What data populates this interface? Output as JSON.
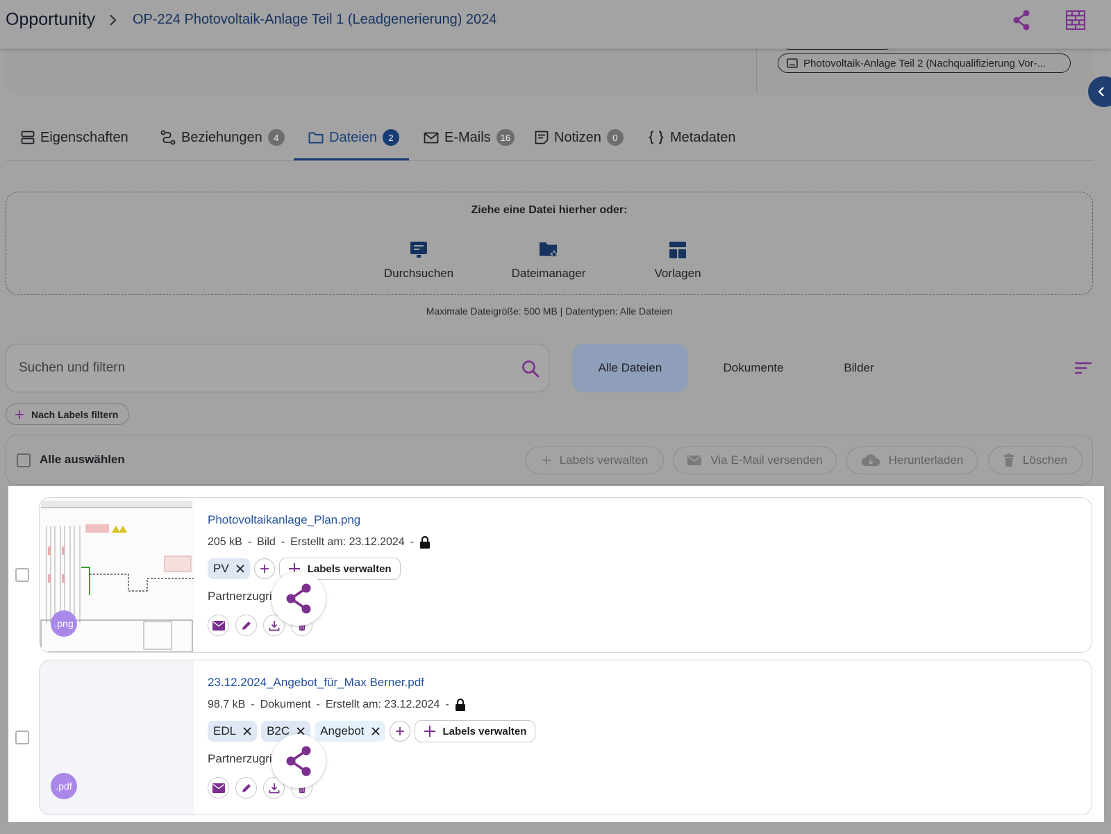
{
  "header": {
    "breadcrumb_root": "Opportunity",
    "breadcrumb_current": "OP-224 Photovoltaik-Anlage Teil 1 (Leadgenerierung) 2024"
  },
  "related": {
    "chip_label": "Photovoltaik-Anlage Teil 2 (Nachqualifizierung Vor-..."
  },
  "tabs": [
    {
      "label": "Eigenschaften",
      "badge": ""
    },
    {
      "label": "Beziehungen",
      "badge": "4"
    },
    {
      "label": "Dateien",
      "badge": "2"
    },
    {
      "label": "E-Mails",
      "badge": "16"
    },
    {
      "label": "Notizen",
      "badge": "0"
    },
    {
      "label": "Metadaten",
      "badge": ""
    }
  ],
  "active_tab": "Dateien",
  "upload": {
    "title": "Ziehe eine Datei hierher oder:",
    "options": [
      "Durchsuchen",
      "Dateimanager",
      "Vorlagen"
    ],
    "info": "Maximale Dateigröße: 500 MB  |  Datentypen: Alle Dateien"
  },
  "search": {
    "placeholder": "Suchen und filtern",
    "value": ""
  },
  "filter_tabs": [
    "Alle Dateien",
    "Dokumente",
    "Bilder"
  ],
  "active_filter": "Alle Dateien",
  "label_filter": "Nach Labels filtern",
  "bulk": {
    "select_all": "Alle auswählen",
    "manage_labels": "Labels verwalten",
    "send_email": "Via E-Mail versenden",
    "download": "Herunterladen",
    "delete": "Löschen"
  },
  "files": [
    {
      "name": "Photovoltaikanlage_Plan.png",
      "size": "205 kB",
      "type": "Bild",
      "created": "Erstellt am: 23.12.2024",
      "ext": ".png",
      "labels": [
        "PV"
      ],
      "manage_labels": "Labels verwalten",
      "partner_access": "Partnerzugriff"
    },
    {
      "name": "23.12.2024_Angebot_für_Max Berner.pdf",
      "size": "98.7 kB",
      "type": "Dokument",
      "created": "Erstellt am: 23.12.2024",
      "ext": ".pdf",
      "labels": [
        "EDL",
        "B2C",
        "Angebot"
      ],
      "manage_labels": "Labels verwalten",
      "partner_access": "Partnerzugriff"
    }
  ],
  "colors": {
    "accent_purple": "#7b2f8e",
    "primary_blue": "#173b75",
    "link_blue": "#2552a0",
    "label_bg": "#dfe7f5",
    "ext_badge": "#a988ea"
  }
}
